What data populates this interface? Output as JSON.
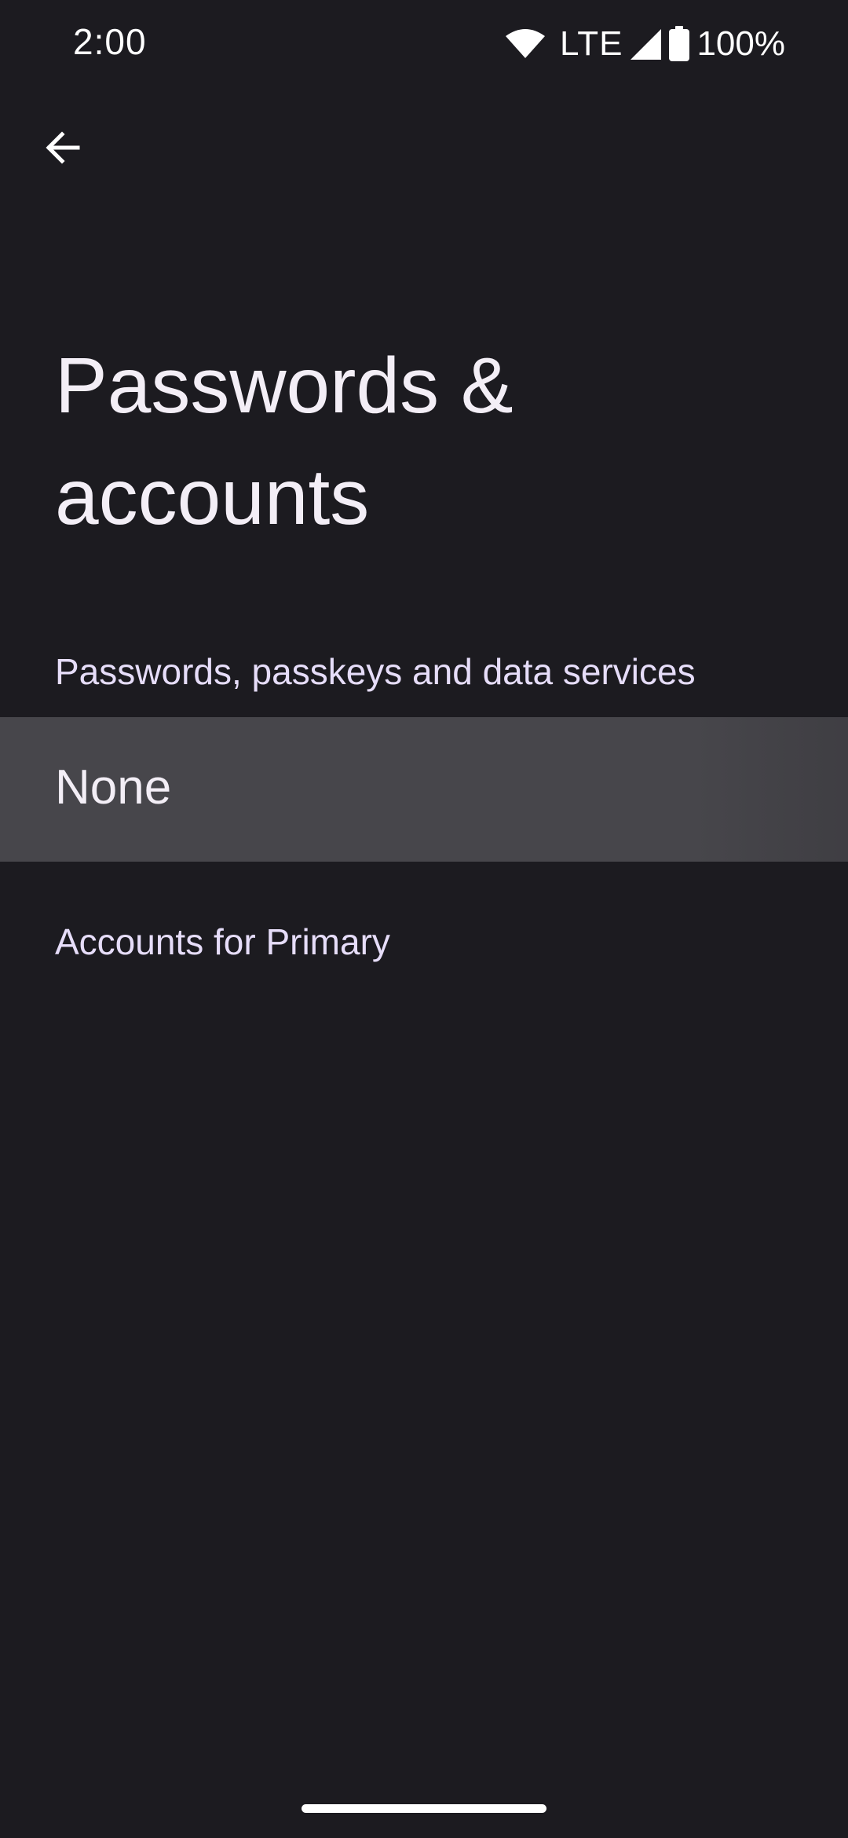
{
  "status_bar": {
    "time": "2:00",
    "network": "LTE",
    "battery": "100%",
    "icons": [
      "wifi-icon",
      "cell-signal-icon",
      "battery-icon"
    ]
  },
  "header": {
    "back_icon": "back-arrow-icon",
    "title": "Passwords & accounts"
  },
  "sections": {
    "passwords": {
      "header": "Passwords, passkeys and data services",
      "items": [
        {
          "label": "None"
        }
      ]
    },
    "accounts": {
      "header": "Accounts for Primary"
    }
  },
  "colors": {
    "background": "#1c1b20",
    "row_background": "#47464b",
    "section_header": "#e6ddf9",
    "text_primary": "#f3eef6"
  }
}
